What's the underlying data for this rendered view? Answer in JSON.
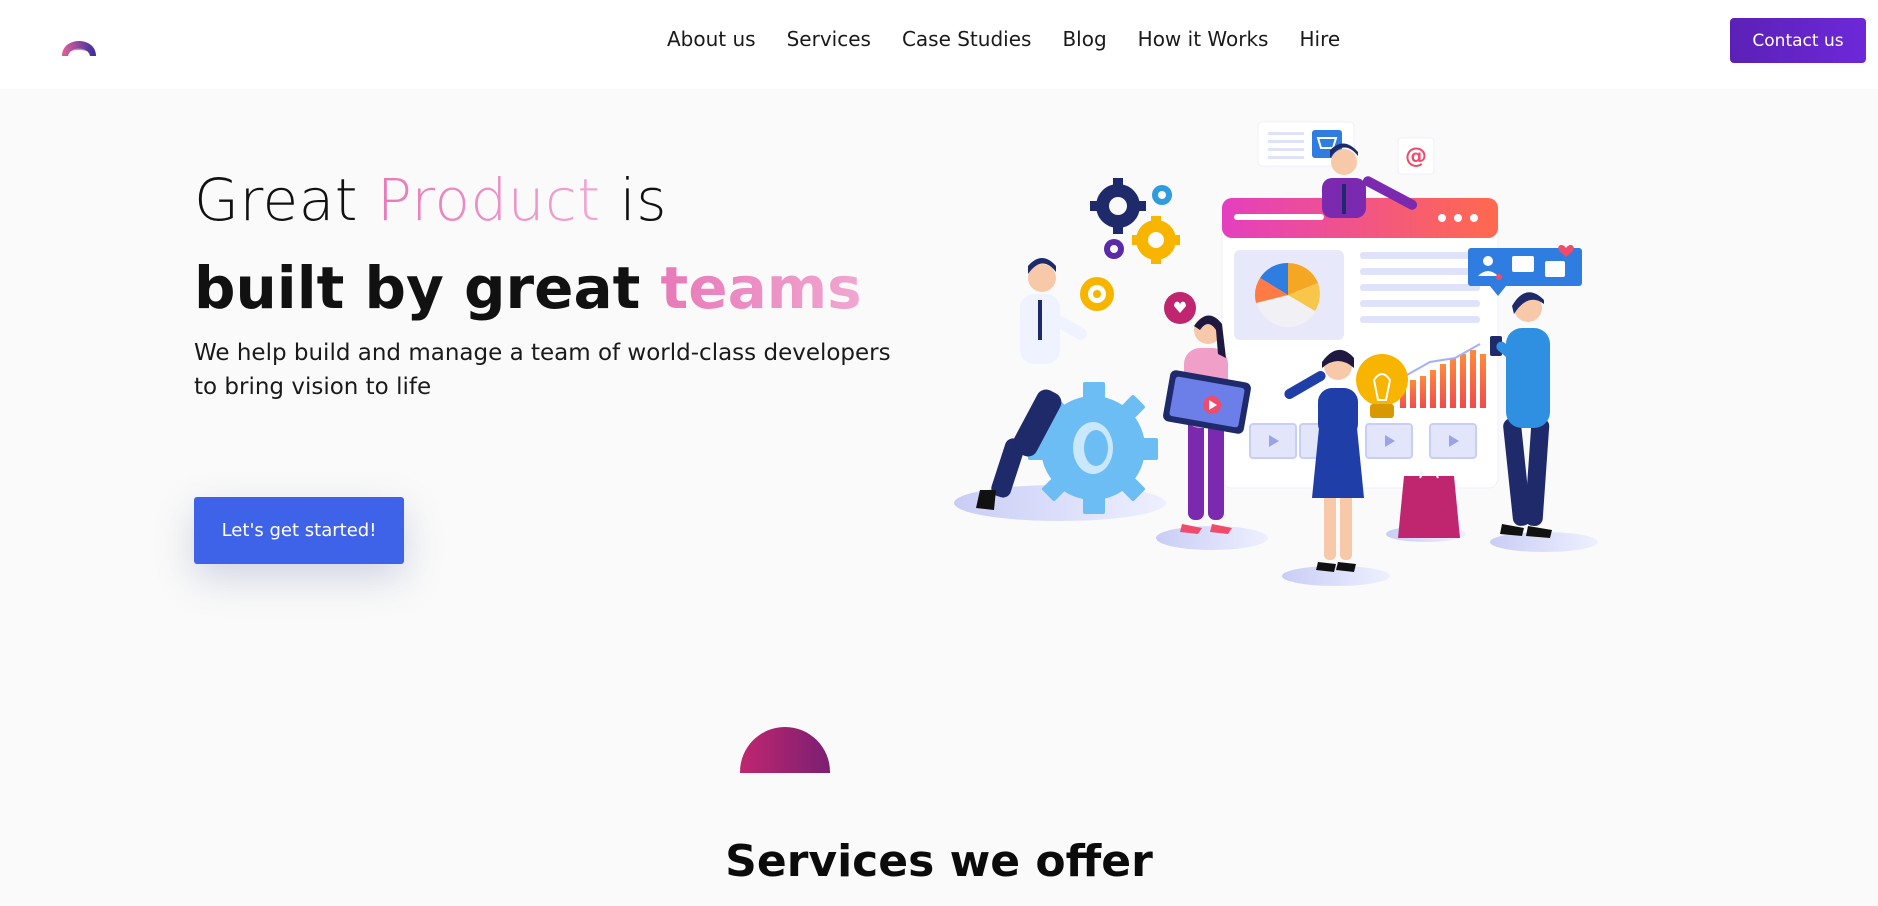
{
  "nav": {
    "links": [
      "About us",
      "Services",
      "Case Studies",
      "Blog",
      "How it Works",
      "Hire"
    ],
    "contact_label": "Contact us"
  },
  "hero": {
    "line1_a": "Great ",
    "line1_highlight": "Product",
    "line1_b": " is",
    "line2_a": "built by great ",
    "line2_highlight": "teams",
    "subtitle": "We help build and manage a team of world-class developers to bring vision to life",
    "cta_label": "Let's get started!"
  },
  "illustration": {
    "at_symbol": "@"
  },
  "services": {
    "title": "Services we offer"
  },
  "colors": {
    "primary_blue": "#3f63e8",
    "contact_purple": "#5b21b6",
    "highlight_pink": "#e879b8"
  }
}
